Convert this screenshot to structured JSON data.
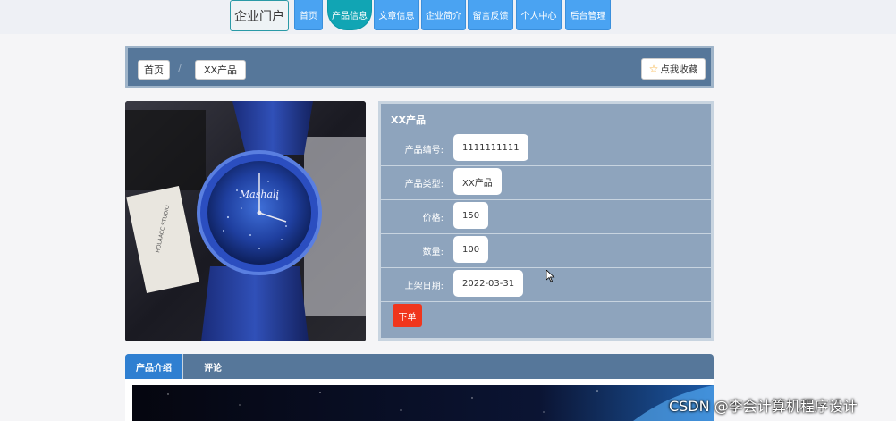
{
  "brand": {
    "logo_text": "企业门户"
  },
  "nav": {
    "items": [
      {
        "label": "首页",
        "active": false
      },
      {
        "label": "产品信息",
        "active": true
      },
      {
        "label": "文章信息",
        "active": false
      },
      {
        "label": "企业简介",
        "active": false
      },
      {
        "label": "留言反馈",
        "active": false
      },
      {
        "label": "个人中心",
        "active": false
      },
      {
        "label": "后台管理",
        "active": false
      }
    ]
  },
  "breadcrumb": {
    "home": "首页",
    "separator": "/",
    "current": "XX产品",
    "favorite_label": "点我收藏"
  },
  "product": {
    "title": "XX产品",
    "fields": [
      {
        "label": "产品编号:",
        "value": "1111111111"
      },
      {
        "label": "产品类型:",
        "value": "XX产品"
      },
      {
        "label": "价格:",
        "value": "150"
      },
      {
        "label": "数量:",
        "value": "100"
      },
      {
        "label": "上架日期:",
        "value": "2022-03-31"
      }
    ],
    "order_button": "下单",
    "image_brand_text": "Mashali",
    "image_tag_text": "HOLAACC STUDIO"
  },
  "tabs": [
    {
      "label": "产品介绍",
      "active": true
    },
    {
      "label": "评论",
      "active": false
    }
  ],
  "watermark": "CSDN @李会计算机程序设计",
  "colors": {
    "nav_blue": "#4aa3f2",
    "nav_active": "#11a5b4",
    "panel_bg": "#56779a",
    "info_bg": "#8ea4bd",
    "order_red": "#f0361d",
    "tab_active": "#2f7fd1"
  }
}
